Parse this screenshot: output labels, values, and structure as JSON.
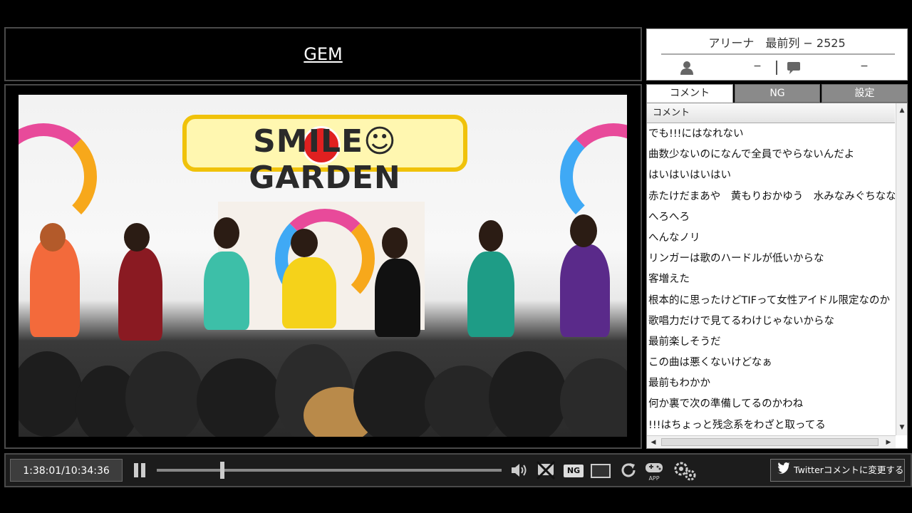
{
  "program": {
    "title": "GEM"
  },
  "channel": {
    "title": "アリーナ　最前列 − 2525",
    "viewer_count": "−",
    "comment_count": "−"
  },
  "tabs": [
    "コメント",
    "NG",
    "設定"
  ],
  "comment_list": {
    "header": "コメント",
    "comments": [
      "でも!!!にはなれない",
      "曲数少ないのになんで全員でやらないんだよ",
      "はいはいはいはい",
      "赤たけだまあや　黄もりおかゆう　水みなみぐちなな",
      "へろへろ",
      "へんなノリ",
      "リンガーは歌のハードルが低いからな",
      "客増えた",
      "根本的に思ったけどTIFって女性アイドル限定なのか",
      "歌唱力だけで見てるわけじゃないからな",
      "最前楽しそうだ",
      "この曲は悪くないけどなぁ",
      "最前もわかか",
      "何か裏で次の準備してるのかわね",
      "!!!はちょっと残念系をわざと取ってる"
    ]
  },
  "player": {
    "time_display": "1:38:01/10:34:36",
    "ng_label": "NG",
    "app_label": "APP",
    "twitter_button_label": "Twitterコメントに変更する",
    "seek_progress": 0.19
  },
  "video": {
    "sign_text": "SMILE☺GARDEN"
  },
  "icons": {
    "viewer": "person-icon",
    "comment": "speech-bubble-icon",
    "pause": "pause-icon",
    "volume": "speaker-icon",
    "comment_toggle": "comment-off-icon",
    "screen": "screen-icon",
    "reload": "reload-icon",
    "app": "gamepad-icon",
    "settings": "gears-icon",
    "twitter": "twitter-bird-icon"
  },
  "colors": {
    "background": "#000000",
    "tab_inactive": "#8a8a8a",
    "panel": "#ffffff"
  }
}
